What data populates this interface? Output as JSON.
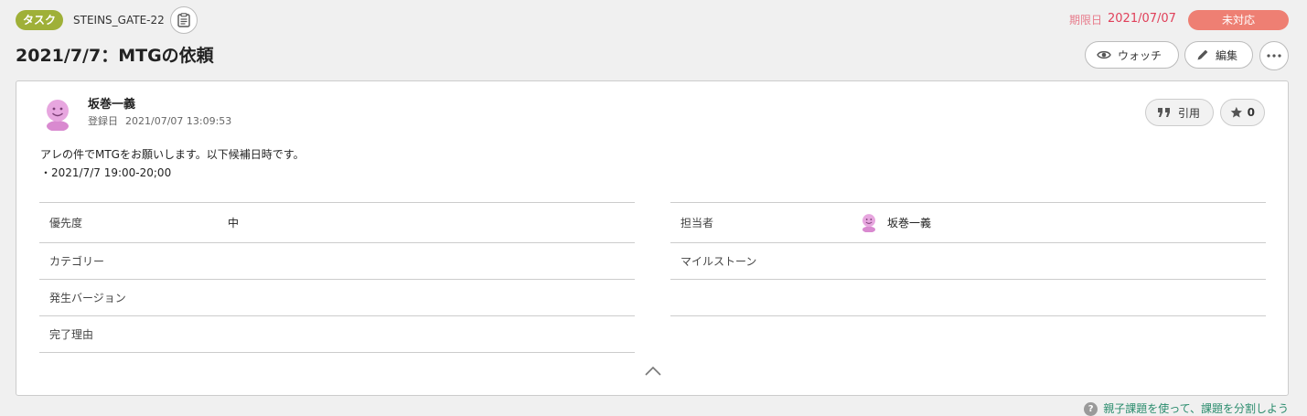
{
  "header": {
    "issue_type": "タスク",
    "issue_key": "STEINS_GATE-22",
    "due_label": "期限日",
    "due_date": "2021/07/07",
    "status": "未対応",
    "title": "2021/7/7：MTGの依頼",
    "watch_label": "ウォッチ",
    "edit_label": "編集"
  },
  "comment": {
    "author": "坂巻一義",
    "registered_label": "登録日",
    "registered_at": "2021/07/07 13:09:53",
    "quote_label": "引用",
    "star_count": "0",
    "description_lines": [
      "アレの件でMTGをお願いします。以下候補日時です。",
      "・2021/7/7 19:00-20;00"
    ]
  },
  "fields": {
    "left": [
      {
        "label": "優先度",
        "value": "中"
      },
      {
        "label": "カテゴリー",
        "value": ""
      },
      {
        "label": "発生バージョン",
        "value": ""
      },
      {
        "label": "完了理由",
        "value": ""
      }
    ],
    "right": [
      {
        "label": "担当者",
        "value": "坂巻一義"
      },
      {
        "label": "マイルストーン",
        "value": ""
      }
    ]
  },
  "footer": {
    "help_text": "親子課題を使って、課題を分割しよう"
  },
  "colors": {
    "type_badge": "#9fb038",
    "status_badge": "#ee7f73",
    "due_date": "#e0405a",
    "link": "#2a8c6d"
  },
  "icons": {
    "copy": "clipboard-icon",
    "watch": "eye-icon",
    "edit": "pencil-icon",
    "more": "more-horizontal-icon",
    "quote": "quote-icon",
    "star": "star-icon",
    "collapse": "chevron-up-icon",
    "help": "question-circle-icon"
  }
}
